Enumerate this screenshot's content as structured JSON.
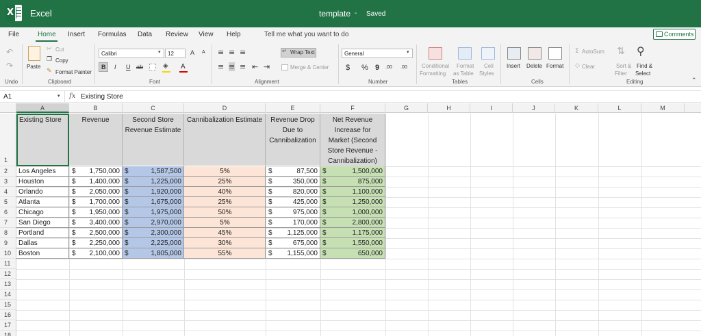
{
  "app": {
    "name": "Excel",
    "doc_title": "template",
    "separator": "-",
    "status": "Saved"
  },
  "tabs": [
    "File",
    "Home",
    "Insert",
    "Formulas",
    "Data",
    "Review",
    "View",
    "Help"
  ],
  "tell_me": "Tell me what you want to do",
  "comments_label": "Comments",
  "ribbon": {
    "undo": "Undo",
    "clipboard": {
      "paste": "Paste",
      "cut": "Cut",
      "copy": "Copy",
      "format_painter": "Format Painter",
      "label": "Clipboard"
    },
    "font": {
      "name": "Calibri",
      "size": "12",
      "grow": "A",
      "shrink": "A",
      "bold": "B",
      "italic": "I",
      "underline": "U",
      "strike": "ab",
      "label": "Font"
    },
    "alignment": {
      "wrap": "Wrap Text",
      "merge": "Merge & Center",
      "label": "Alignment"
    },
    "number": {
      "format": "General",
      "currency": "$",
      "percent": "%",
      "comma": "9",
      "inc_dec": ".00",
      "dec_dec": ".00",
      "label": "Number"
    },
    "tables": {
      "conditional": "Conditional",
      "formatting": "Formatting",
      "format": "Format",
      "as_table": "as Table",
      "cell": "Cell",
      "styles": "Styles",
      "label": "Tables"
    },
    "cells": {
      "insert": "Insert",
      "delete": "Delete",
      "format": "Format",
      "label": "Cells"
    },
    "editing": {
      "autosum": "AutoSum",
      "clear": "Clear",
      "sort1": "Sort &",
      "sort2": "Filter",
      "find1": "Find &",
      "find2": "Select",
      "label": "Editing"
    }
  },
  "formula_bar": {
    "cell_ref": "A1",
    "fx": "fx",
    "content": "Existing Store"
  },
  "columns": [
    "A",
    "B",
    "C",
    "D",
    "E",
    "F",
    "G",
    "H",
    "I",
    "J",
    "K",
    "L",
    "M"
  ],
  "row_numbers": [
    "1",
    "2",
    "3",
    "4",
    "5",
    "6",
    "7",
    "8",
    "9",
    "10",
    "11",
    "12",
    "13",
    "14",
    "15",
    "16",
    "17",
    "18"
  ],
  "headers": {
    "a": "Existing Store",
    "b": "Revenue",
    "c1": "Second Store",
    "c2": "Revenue Estimate",
    "d": "Cannibalization Estimate",
    "e1": "Revenue Drop",
    "e2": "Due to",
    "e3": "Cannibalization",
    "f1": "Net Revenue",
    "f2": "Increase for",
    "f3": "Market (Second",
    "f4": "Store Revenue -",
    "f5": "Cannibalization)"
  },
  "currency_symbol": "$",
  "rows": [
    {
      "store": "Los Angeles",
      "revenue": "1,750,000",
      "second": "1,587,500",
      "cannib": "5%",
      "drop": "87,500",
      "net": "1,500,000"
    },
    {
      "store": "Houston",
      "revenue": "1,400,000",
      "second": "1,225,000",
      "cannib": "25%",
      "drop": "350,000",
      "net": "875,000"
    },
    {
      "store": "Orlando",
      "revenue": "2,050,000",
      "second": "1,920,000",
      "cannib": "40%",
      "drop": "820,000",
      "net": "1,100,000"
    },
    {
      "store": "Atlanta",
      "revenue": "1,700,000",
      "second": "1,675,000",
      "cannib": "25%",
      "drop": "425,000",
      "net": "1,250,000"
    },
    {
      "store": "Chicago",
      "revenue": "1,950,000",
      "second": "1,975,000",
      "cannib": "50%",
      "drop": "975,000",
      "net": "1,000,000"
    },
    {
      "store": "San Diego",
      "revenue": "3,400,000",
      "second": "2,970,000",
      "cannib": "5%",
      "drop": "170,000",
      "net": "2,800,000"
    },
    {
      "store": "Portland",
      "revenue": "2,500,000",
      "second": "2,300,000",
      "cannib": "45%",
      "drop": "1,125,000",
      "net": "1,175,000"
    },
    {
      "store": "Dallas",
      "revenue": "2,250,000",
      "second": "2,225,000",
      "cannib": "30%",
      "drop": "675,000",
      "net": "1,550,000"
    },
    {
      "store": "Boston",
      "revenue": "2,100,000",
      "second": "1,805,000",
      "cannib": "55%",
      "drop": "1,155,000",
      "net": "650,000"
    }
  ]
}
